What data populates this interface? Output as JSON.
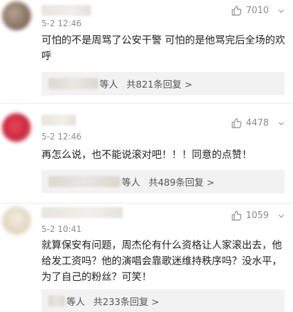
{
  "comments": [
    {
      "date": "5-2 12:46",
      "likes": "7010",
      "text": "可怕的不是周骂了公安干警 可怕的是他骂完后全场的欢呼",
      "reply_people": "等人",
      "reply_count": "共821条回复 >"
    },
    {
      "date": "5-2 12:46",
      "likes": "4478",
      "text": "再怎么说，也不能说滚对吧！！！同意的点赞！",
      "reply_people": "等人",
      "reply_count": "共489条回复 >"
    },
    {
      "date": "5-2 10:41",
      "likes": "1059",
      "text": "就算保安有问题，周杰伦有什么资格让人家滚出去，他给发工资吗？他的演唱会靠歌迷维持秩序吗？没水平，为了自己的粉丝？可笑！",
      "reply_people": "等人",
      "reply_count": "共233条回复 >"
    }
  ],
  "icons": {
    "like": "thumbs-up-icon",
    "dislike": "thumbs-down-icon"
  }
}
